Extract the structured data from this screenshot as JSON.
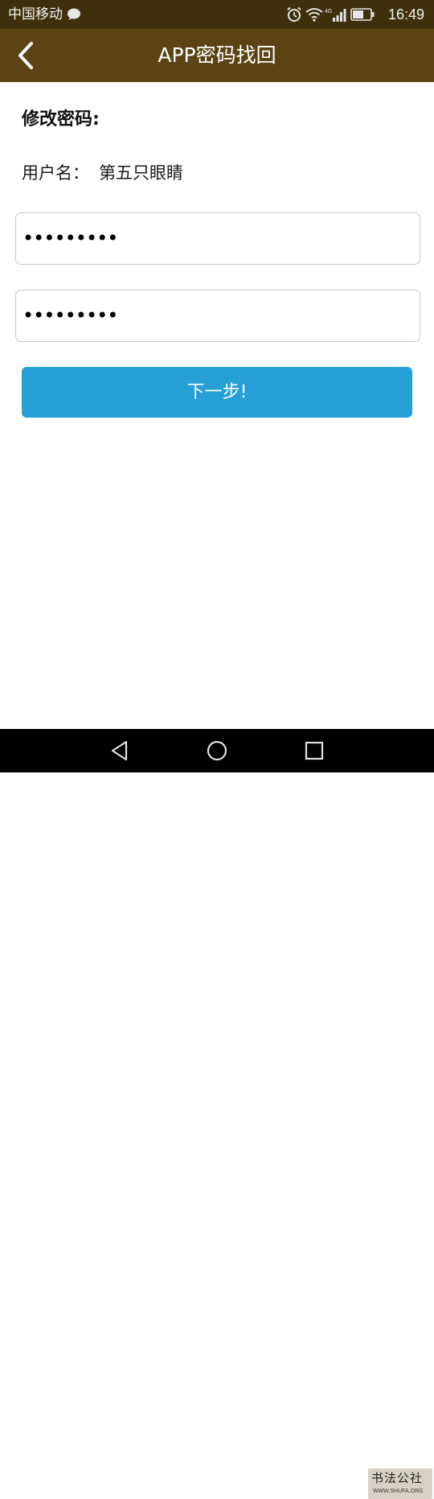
{
  "status_bar": {
    "carrier": "中国移动",
    "network_label": "4G",
    "time": "16:49",
    "icons": [
      "message-icon",
      "alarm-icon",
      "wifi-icon",
      "signal-icon",
      "battery-icon"
    ]
  },
  "header": {
    "back_icon": "chevron-left-icon",
    "title": "APP密码找回"
  },
  "form": {
    "section_title": "修改密码:",
    "username_label": "用户名：",
    "username_value": "第五只眼睛",
    "password_masked": "•••••••••",
    "confirm_password_masked": "•••••••••",
    "next_button_label": "下一步!"
  },
  "nav_bar": {
    "icons": [
      "triangle-back-icon",
      "circle-home-icon",
      "square-recents-icon"
    ]
  },
  "watermark": {
    "text": "书法公社",
    "url": "WWW.SHUFA.ORG"
  },
  "colors": {
    "status_bar_bg": "#3f2f0c",
    "title_bar_bg": "#5b4314",
    "button_bg": "#259fd6",
    "field_border": "#c9c9c9"
  }
}
